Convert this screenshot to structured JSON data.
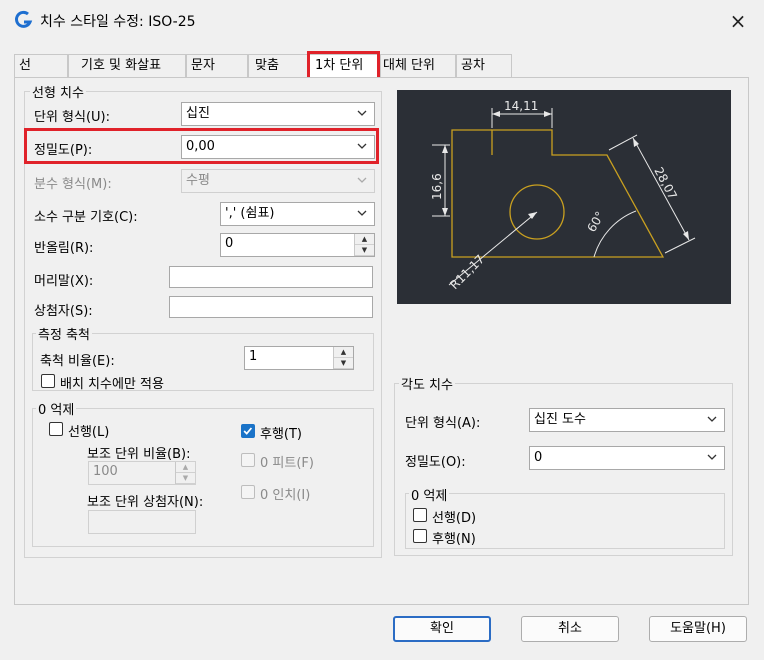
{
  "window": {
    "title": "치수 스타일 수정: ISO-25",
    "close_icon": "×"
  },
  "tabs": [
    "선",
    "기호 및 화살표",
    "문자",
    "맞춤",
    "1차 단위",
    "대체 단위",
    "공차"
  ],
  "linear": {
    "legend": "선형 치수",
    "unit_format_label": "단위 형식(U):",
    "unit_format_value": "십진",
    "precision_label": "정밀도(P):",
    "precision_value": "0,00",
    "fraction_format_label": "분수 형식(M):",
    "fraction_format_value": "수평",
    "decimal_sep_label": "소수 구분 기호(C):",
    "decimal_sep_value": "',' (쉼표)",
    "roundoff_label": "반올림(R):",
    "roundoff_value": "0",
    "prefix_label": "머리말(X):",
    "prefix_value": "",
    "suffix_label": "상첨자(S):",
    "suffix_value": ""
  },
  "scale": {
    "legend": "측정 축척",
    "factor_label": "축척 비율(E):",
    "factor_value": "1",
    "layout_only_label": "배치 치수에만 적용"
  },
  "zero_linear": {
    "legend": "0 억제",
    "leading_label": "선행(L)",
    "trailing_label": "후행(T)",
    "sub_factor_label": "보조 단위 비율(B):",
    "sub_factor_value": "100",
    "sub_suffix_label": "보조 단위 상첨자(N):",
    "feet_label": "0 피트(F)",
    "inches_label": "0 인치(I)"
  },
  "preview": {
    "dim_top": "14,11",
    "dim_left": "16,6",
    "dim_right": "28,07",
    "dim_radius": "R11,17",
    "dim_angle": "60°"
  },
  "angular": {
    "legend": "각도 치수",
    "unit_format_label": "단위 형식(A):",
    "unit_format_value": "십진 도수",
    "precision_label": "정밀도(O):",
    "precision_value": "0",
    "zero_legend": "0 억제",
    "leading_label": "선행(D)",
    "trailing_label": "후행(N)"
  },
  "buttons": {
    "ok": "확인",
    "cancel": "취소",
    "help": "도움말(H)"
  },
  "colors": {
    "highlight": "#e0222a",
    "accent": "#1a73c8",
    "preview_bg": "#2b2f36",
    "geometry": "#c9a020"
  }
}
